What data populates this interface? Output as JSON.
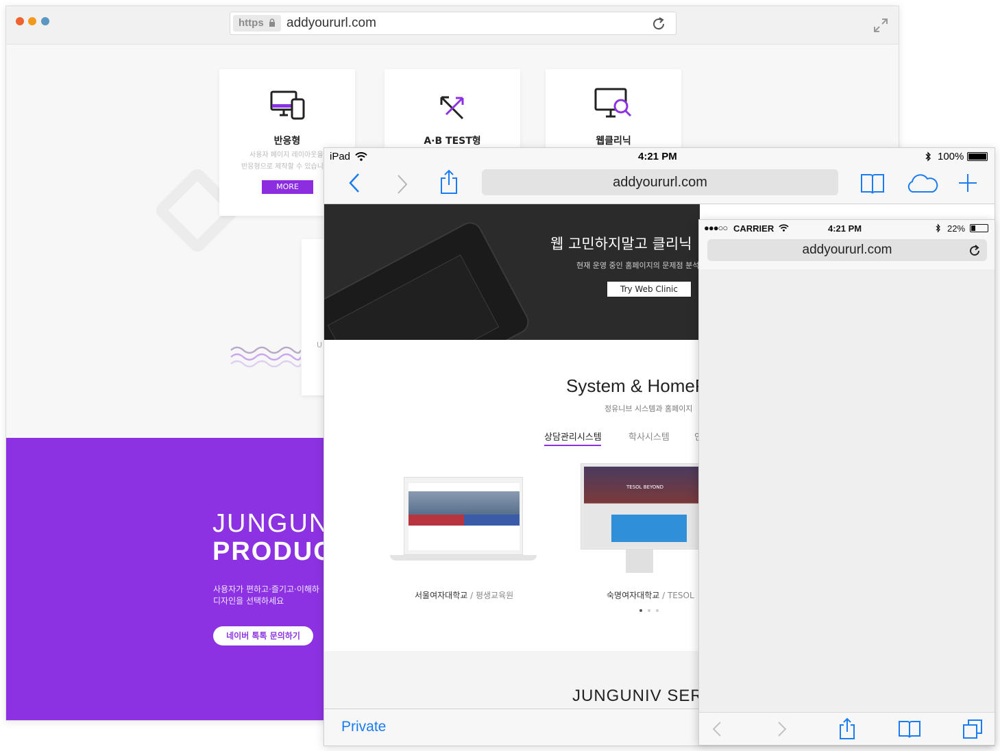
{
  "colors": {
    "purple": "#8d32e2",
    "ios_blue": "#1a7cf0",
    "dark_hero": "#2b2b2b"
  },
  "desktop": {
    "window_controls": [
      "close-dot",
      "minimize-dot",
      "zoom-dot"
    ],
    "address_bar": {
      "scheme": "https",
      "url": "addyoururl.com",
      "icons": [
        "lock-icon",
        "reload-icon"
      ]
    },
    "fullscreen_icon": "expand-icon",
    "cards": [
      {
        "icon": "responsive-devices-icon",
        "title": "반응형",
        "desc": [
          "사용자 페이지 레이아웃을",
          "반응형으로 제작할 수 있습니"
        ],
        "button": "MORE"
      },
      {
        "icon": "ab-test-arrows-icon",
        "title": "A·B TEST형"
      },
      {
        "icon": "web-clinic-monitor-icon",
        "title": "웹클리닉"
      }
    ],
    "hidden_card_letter": "U",
    "promo": {
      "line1": "JUNGUNI",
      "line2": "PRODUC",
      "desc1": "사용자가 편하고·즐기고·이해하",
      "desc2": "디자인을 선택하세요",
      "button": "네이버 톡톡 문의하기"
    }
  },
  "ipad": {
    "status": {
      "device": "iPad",
      "time": "4:21 PM",
      "battery": "100%"
    },
    "nav": {
      "url": "addyoururl.com",
      "icons": [
        "back-icon",
        "forward-icon",
        "share-icon",
        "bookmarks-icon",
        "icloud-tabs-icon",
        "new-tab-icon"
      ]
    },
    "hero": {
      "title": "웹 고민하지말고 클리닉",
      "subtitle": "현재 운영 중인 홈페이지의 문제점 분석",
      "button": "Try Web Clinic"
    },
    "section": {
      "title": "System & HomeP",
      "subtitle": "정유니브 시스템과 홈페이지",
      "tabs": [
        {
          "label": "상담관리시스템",
          "active": true
        },
        {
          "label": "학사시스템",
          "active": false
        },
        {
          "label": "인",
          "active": false
        }
      ],
      "items": [
        {
          "name": "서울여자대학교",
          "sub": "/ 평생교육원"
        },
        {
          "name": "숙명여자대학교",
          "sub": "/ TESOL"
        }
      ],
      "pager": {
        "current": 1,
        "total": 3
      },
      "laptop_screen_text": "TESOL BEYOND"
    },
    "services_title": "JUNGUNIV SERV",
    "toolbar": {
      "private_label": "Private"
    }
  },
  "iphone": {
    "status": {
      "carrier": "CARRIER",
      "time": "4:21 PM",
      "battery": "22%"
    },
    "url": "addyoururl.com",
    "toolbar_icons": [
      "back-icon",
      "forward-icon",
      "share-icon",
      "bookmarks-icon",
      "tabs-icon"
    ]
  }
}
